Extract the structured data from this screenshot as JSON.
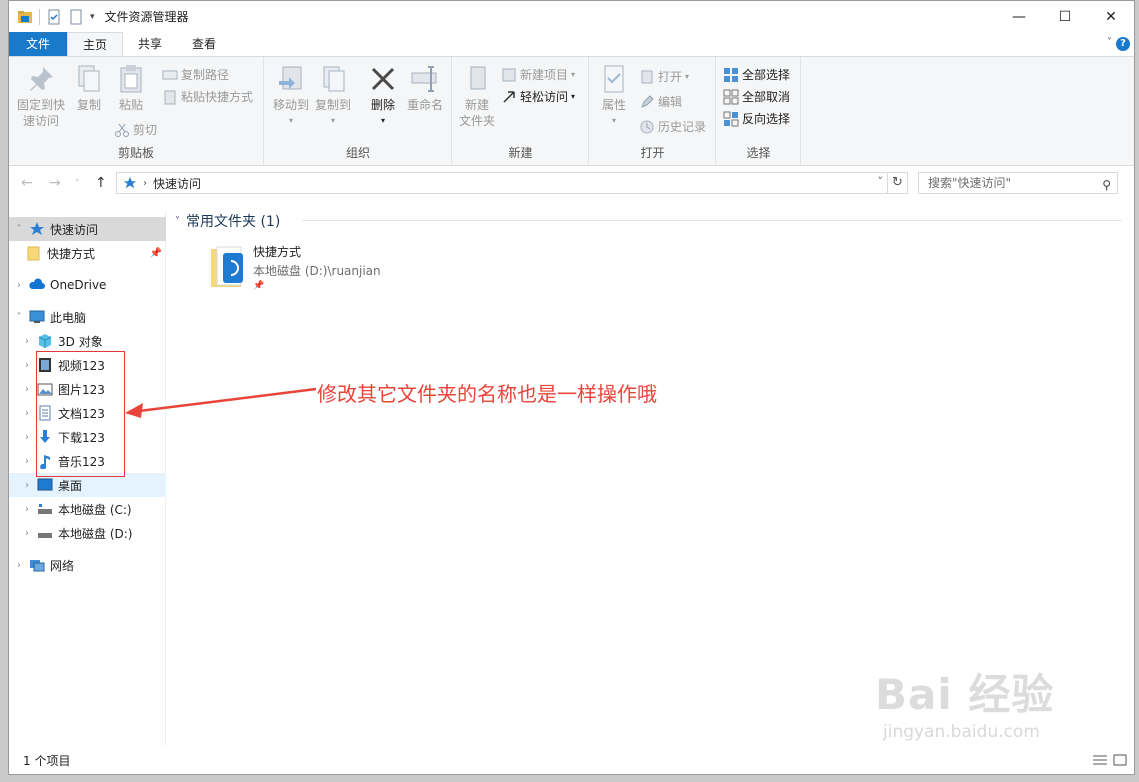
{
  "window": {
    "title": "文件资源管理器",
    "controls": {
      "minimize": "—",
      "maximize": "☐",
      "close": "✕"
    }
  },
  "ribbon_tabs": [
    {
      "label": "文件"
    },
    {
      "label": "主页"
    },
    {
      "label": "共享"
    },
    {
      "label": "查看"
    }
  ],
  "ribbon": {
    "clipboard": {
      "label": "剪贴板",
      "pin_quick": "固定到快\n速访问",
      "copy": "复制",
      "paste": "粘贴",
      "copy_path": "复制路径",
      "paste_shortcut": "粘贴快捷方式",
      "cut": "剪切"
    },
    "organize": {
      "label": "组织",
      "move_to": "移动到",
      "copy_to": "复制到",
      "delete": "删除",
      "rename": "重命名"
    },
    "new": {
      "label": "新建",
      "new_folder": "新建\n文件夹",
      "new_item": "新建项目",
      "easy_access": "轻松访问"
    },
    "open": {
      "label": "打开",
      "properties": "属性",
      "open": "打开",
      "edit": "编辑",
      "history": "历史记录"
    },
    "select": {
      "label": "选择",
      "select_all": "全部选择",
      "select_none": "全部取消",
      "invert": "反向选择"
    }
  },
  "address": {
    "path": "快速访问",
    "search_placeholder": "搜索\"快速访问\""
  },
  "nav_pane": {
    "items": [
      {
        "label": "快速访问",
        "icon": "star-icon"
      },
      {
        "label": "快捷方式",
        "icon": "folder-icon"
      },
      {
        "label": "OneDrive",
        "icon": "cloud-icon"
      },
      {
        "label": "此电脑",
        "icon": "computer-icon"
      },
      {
        "label": "3D 对象",
        "icon": "cube-icon"
      },
      {
        "label": "视频123",
        "icon": "video-icon"
      },
      {
        "label": "图片123",
        "icon": "picture-icon"
      },
      {
        "label": "文档123",
        "icon": "document-icon"
      },
      {
        "label": "下载123",
        "icon": "download-icon"
      },
      {
        "label": "音乐123",
        "icon": "music-icon"
      },
      {
        "label": "桌面",
        "icon": "desktop-icon"
      },
      {
        "label": "本地磁盘 (C:)",
        "icon": "drive-icon"
      },
      {
        "label": "本地磁盘 (D:)",
        "icon": "drive-icon"
      },
      {
        "label": "网络",
        "icon": "network-icon"
      }
    ]
  },
  "content": {
    "group_header": "常用文件夹 (1)",
    "folder": {
      "name": "快捷方式",
      "path": "本地磁盘 (D:)\\ruanjian"
    }
  },
  "annotation": "修改其它文件夹的名称也是一样操作哦",
  "status": {
    "count": "1 个项目"
  },
  "watermark": {
    "big": "Bai 经验",
    "small": "jingyan.baidu.com"
  },
  "colors": {
    "accent": "#1979ca",
    "annotation": "#e8443a"
  }
}
